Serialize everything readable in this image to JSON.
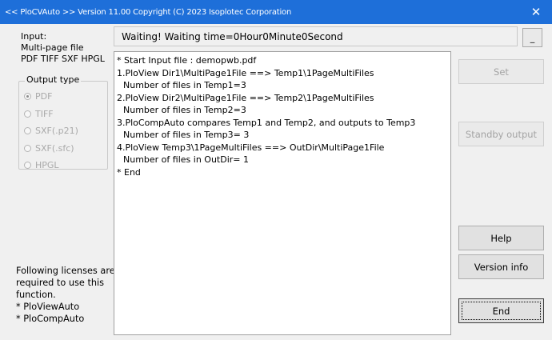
{
  "window": {
    "title": "<< PloCVAuto >> Version 11.00 Copyright (C) 2023 Isoplotec Corporation",
    "close_glyph": "✕"
  },
  "left_panel": {
    "input_label": "Input:",
    "input_desc_line1": "Multi-page file",
    "input_desc_line2": "PDF TIFF SXF HPGL"
  },
  "output_type": {
    "legend": "Output type",
    "options": [
      {
        "label": "PDF",
        "checked": true
      },
      {
        "label": "TIFF",
        "checked": false
      },
      {
        "label": "SXF(.p21)",
        "checked": false
      },
      {
        "label": "SXF(.sfc)",
        "checked": false
      },
      {
        "label": "HPGL",
        "checked": false
      }
    ]
  },
  "license": {
    "line1": "Following licenses are",
    "line2": "required to use this",
    "line3": "function.",
    "line4": "* PloViewAuto",
    "line5": "* PloCompAuto"
  },
  "status": {
    "text": "Waiting!  Waiting time=0Hour0Minute0Second",
    "minimize_label": "_"
  },
  "log": {
    "lines": [
      {
        "text": "* Start Input file : demopwb.pdf",
        "indent": false
      },
      {
        "text": "1.PloView  Dir1\\MultiPage1File ==> Temp1\\1PageMultiFiles",
        "indent": false
      },
      {
        "text": "Number of files in Temp1=3",
        "indent": true
      },
      {
        "text": "2.PloView  Dir2\\MultiPage1File ==> Temp2\\1PageMultiFiles",
        "indent": false
      },
      {
        "text": "Number of files in Temp2=3",
        "indent": true
      },
      {
        "text": "3.PloCompAuto compares Temp1 and Temp2, and outputs to Temp3",
        "indent": false
      },
      {
        "text": "Number of files in Temp3= 3",
        "indent": true
      },
      {
        "text": "4.PloView  Temp3\\1PageMultiFiles ==> OutDir\\MultiPage1File",
        "indent": false
      },
      {
        "text": "Number of files in OutDir= 1",
        "indent": true
      },
      {
        "text": "* End",
        "indent": false
      }
    ]
  },
  "buttons": {
    "set": "Set",
    "standby_output": "Standby output",
    "help": "Help",
    "version_info": "Version info",
    "end": "End"
  }
}
